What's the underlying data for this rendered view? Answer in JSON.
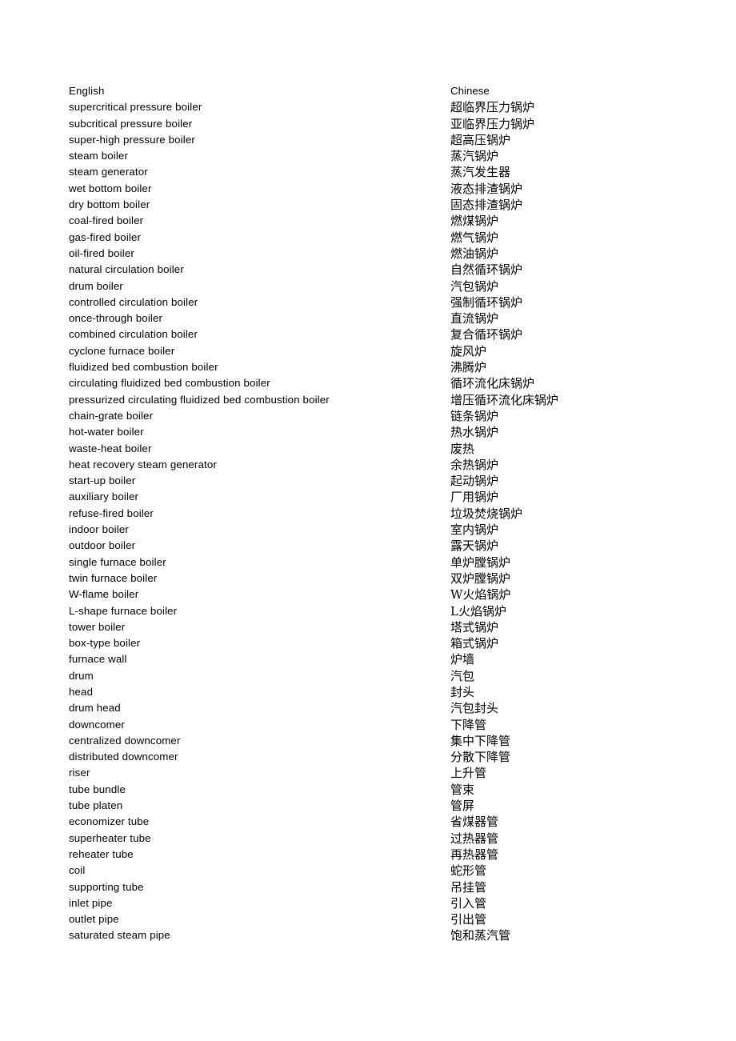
{
  "document": {
    "columns": {
      "english_header": "English",
      "chinese_header": "Chinese"
    },
    "entries": [
      {
        "en": "supercritical pressure boiler",
        "zh": "超临界压力锅炉"
      },
      {
        "en": "subcritical pressure boiler",
        "zh": "亚临界压力锅炉"
      },
      {
        "en": "super-high pressure boiler",
        "zh": "超高压锅炉"
      },
      {
        "en": "steam boiler",
        "zh": "蒸汽锅炉"
      },
      {
        "en": "steam generator",
        "zh": "蒸汽发生器"
      },
      {
        "en": "wet bottom boiler",
        "zh": "液态排渣锅炉"
      },
      {
        "en": "dry bottom boiler",
        "zh": "固态排渣锅炉"
      },
      {
        "en": "coal-fired boiler",
        "zh": "燃煤锅炉"
      },
      {
        "en": "gas-fired boiler",
        "zh": "燃气锅炉"
      },
      {
        "en": "oil-fired boiler",
        "zh": "燃油锅炉"
      },
      {
        "en": "natural circulation boiler",
        "zh": "自然循环锅炉"
      },
      {
        "en": "drum boiler",
        "zh": "汽包锅炉"
      },
      {
        "en": "controlled circulation boiler",
        "zh": "强制循环锅炉"
      },
      {
        "en": "once-through boiler",
        "zh": "直流锅炉"
      },
      {
        "en": "combined circulation boiler",
        "zh": "复合循环锅炉"
      },
      {
        "en": "cyclone furnace boiler",
        "zh": "旋风炉"
      },
      {
        "en": "fluidized bed combustion boiler",
        "zh": "沸腾炉"
      },
      {
        "en": "circulating fluidized bed combustion boiler",
        "zh": "循环流化床锅炉"
      },
      {
        "en": "pressurized circulating fluidized bed combustion boiler",
        "zh": "增压循环流化床锅炉"
      },
      {
        "en": "chain-grate boiler",
        "zh": "链条锅炉"
      },
      {
        "en": "hot-water boiler",
        "zh": "热水锅炉"
      },
      {
        "en": "waste-heat boiler",
        "zh": "废热"
      },
      {
        "en": "heat recovery steam generator",
        "zh": "余热锅炉"
      },
      {
        "en": "start-up boiler",
        "zh": "起动锅炉"
      },
      {
        "en": "auxiliary boiler",
        "zh": "厂用锅炉"
      },
      {
        "en": "refuse-fired boiler",
        "zh": "垃圾焚烧锅炉"
      },
      {
        "en": "indoor boiler",
        "zh": "室内锅炉"
      },
      {
        "en": "outdoor boiler",
        "zh": "露天锅炉"
      },
      {
        "en": "single furnace boiler",
        "zh": "单炉膛锅炉"
      },
      {
        "en": "twin furnace boiler",
        "zh": "双炉膛锅炉"
      },
      {
        "en": "W-flame boiler",
        "zh": "W火焰锅炉"
      },
      {
        "en": "L-shape furnace boiler",
        "zh": "L火焰锅炉"
      },
      {
        "en": "tower boiler",
        "zh": "塔式锅炉"
      },
      {
        "en": "box-type boiler",
        "zh": "箱式锅炉"
      },
      {
        "en": "furnace wall",
        "zh": "炉墙"
      },
      {
        "en": "drum",
        "zh": "汽包"
      },
      {
        "en": "head",
        "zh": "封头"
      },
      {
        "en": "drum head",
        "zh": "汽包封头"
      },
      {
        "en": "downcomer",
        "zh": "下降管"
      },
      {
        "en": "centralized downcomer",
        "zh": "集中下降管"
      },
      {
        "en": "distributed downcomer",
        "zh": "分散下降管"
      },
      {
        "en": "riser",
        "zh": "上升管"
      },
      {
        "en": "tube bundle",
        "zh": "管束"
      },
      {
        "en": "tube platen",
        "zh": "管屏"
      },
      {
        "en": "economizer tube",
        "zh": "省煤器管"
      },
      {
        "en": "superheater tube",
        "zh": "过热器管"
      },
      {
        "en": "reheater tube",
        "zh": "再热器管"
      },
      {
        "en": "coil",
        "zh": "蛇形管"
      },
      {
        "en": "supporting tube",
        "zh": "吊挂管"
      },
      {
        "en": "inlet pipe",
        "zh": "引入管"
      },
      {
        "en": "outlet pipe",
        "zh": "引出管"
      },
      {
        "en": "saturated steam pipe",
        "zh": "饱和蒸汽管"
      }
    ]
  }
}
